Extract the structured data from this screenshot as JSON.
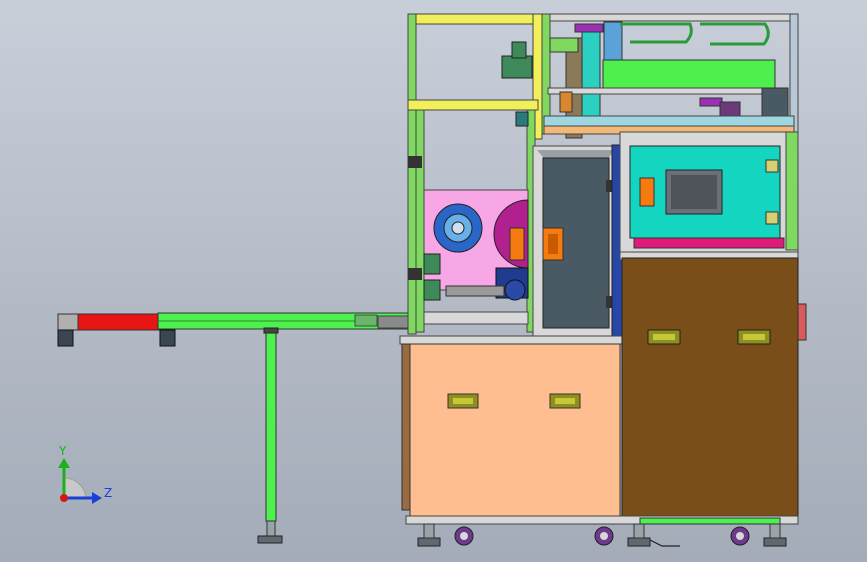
{
  "view": {
    "background_top": "#c9cfd9",
    "background_bottom": "#a4acb9"
  },
  "triad": {
    "y_label": "Y",
    "z_label": "Z",
    "y_color": "#19b219",
    "z_color": "#1a3fd6",
    "x_color": "#d01818"
  },
  "colors": {
    "frame_yellow": "#f2f05a",
    "frame_green": "#7fd860",
    "conveyor_green": "#4df04d",
    "conveyor_red": "#e81515",
    "cabinet_peach": "#ffbe8f",
    "cabinet_brown": "#7a4e18",
    "panel_cyan": "#14d6c0",
    "panel_magenta": "#e0197a",
    "printer_pink": "#f7a6e6",
    "slate": "#4a5a64",
    "handle_olive": "#8f8f1f",
    "orange": "#f57a10",
    "roll_blue": "#2a66c8",
    "roll_purple": "#b21f8f",
    "motor_navy": "#1f3c8f"
  }
}
